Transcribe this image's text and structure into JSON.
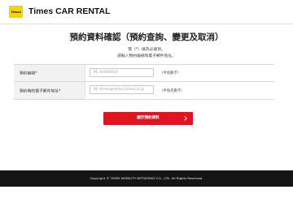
{
  "header": {
    "logo_text": "Times",
    "brand": "Times CAR RENTAL"
  },
  "page": {
    "title": "預約資料確認（預約查詢、變更及取消）",
    "note1": "需（*）填為必填項。",
    "note2": "請輸入預約編號和電子郵件地址。"
  },
  "form": {
    "reservation_number": {
      "label": "預約編號*",
      "placeholder": "例: 00000000",
      "value": "",
      "hint": "（半角數字）"
    },
    "email": {
      "label": "預約時的電子郵件地址*",
      "placeholder": "例: times@rental.timescar.jp",
      "value": "",
      "hint": "（半角英數字）"
    }
  },
  "submit": {
    "label": "顯示預約資料"
  },
  "footer": {
    "copyright": "Copyright © TIMES MOBILITY NETWORKS CO., LTD. All Rights Reserved."
  },
  "colors": {
    "brand_yellow": "#f5d400",
    "submit_red": "#e2141f",
    "footer_bg": "#141414",
    "label_bg": "#f2f2f2"
  }
}
